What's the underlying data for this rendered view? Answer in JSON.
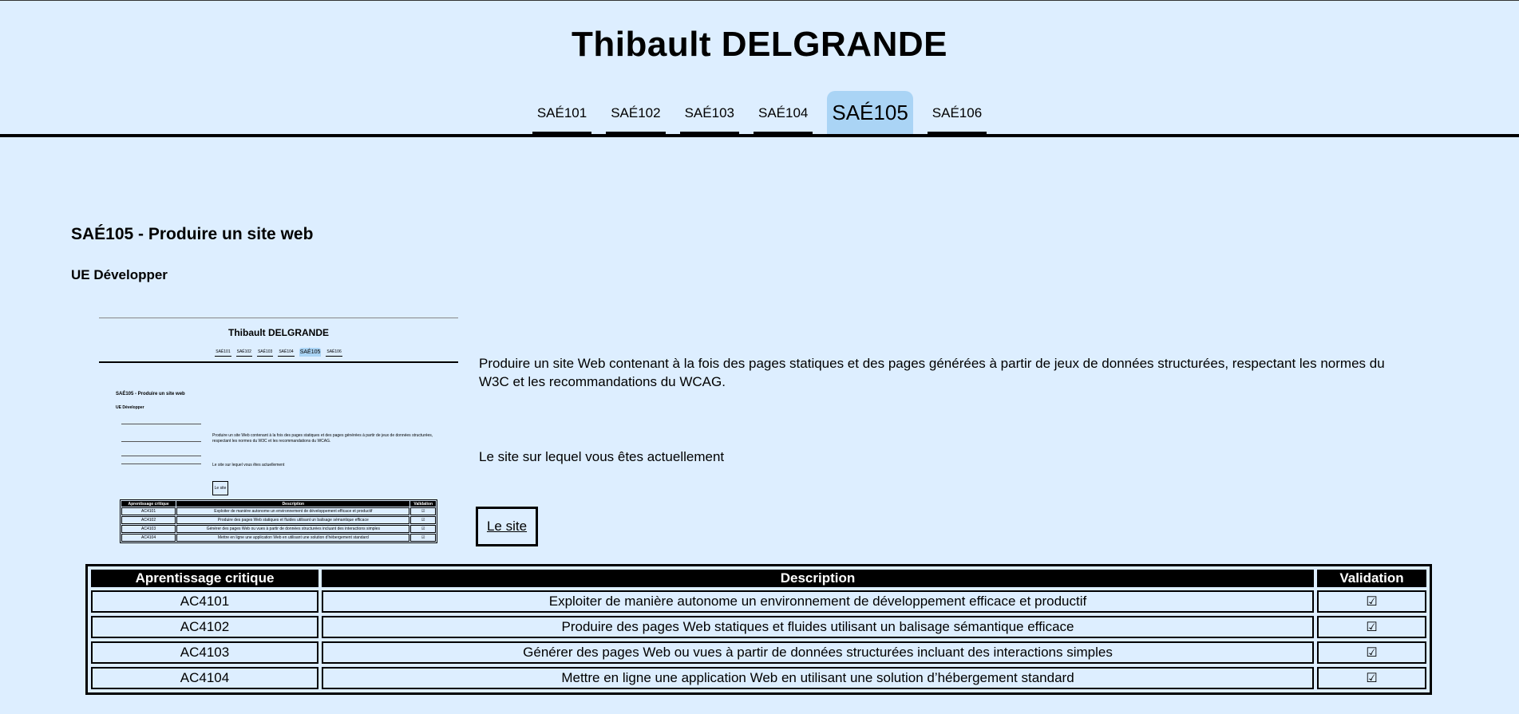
{
  "header": {
    "title": "Thibault DELGRANDE",
    "nav": [
      "SAÉ101",
      "SAÉ102",
      "SAÉ103",
      "SAÉ104",
      "SAÉ105",
      "SAÉ106"
    ],
    "active_tab": "SAÉ105"
  },
  "main": {
    "heading": "SAÉ105 - Produire un site web",
    "subheading": "UE Développer",
    "description": "Produire un site Web contenant à la fois des pages statiques et des pages générées à partir de jeux de données structurées, respectant les normes du W3C et les recommandations du WCAG.",
    "current_site_text": "Le site sur lequel vous êtes actuellement",
    "site_button": "Le site"
  },
  "table": {
    "headers": [
      "Aprentissage critique",
      "Description",
      "Validation"
    ],
    "rows": [
      {
        "code": "AC4101",
        "description": "Exploiter de manière autonome un environnement de développement efficace et productif",
        "validation": "☑"
      },
      {
        "code": "AC4102",
        "description": "Produire des pages Web statiques et fluides utilisant un balisage sémantique efficace",
        "validation": "☑"
      },
      {
        "code": "AC4103",
        "description": "Générer des pages Web ou vues à partir de données structurées incluant des interactions simples",
        "validation": "☑"
      },
      {
        "code": "AC4104",
        "description": "Mettre en ligne une application Web en utilisant une solution d’hébergement standard",
        "validation": "☑"
      }
    ]
  },
  "colors": {
    "background": "#ddeeff",
    "active_tab": "#aad4f5",
    "table_header": "#000000"
  },
  "icons": {
    "check": "checkbox-checked-icon"
  }
}
